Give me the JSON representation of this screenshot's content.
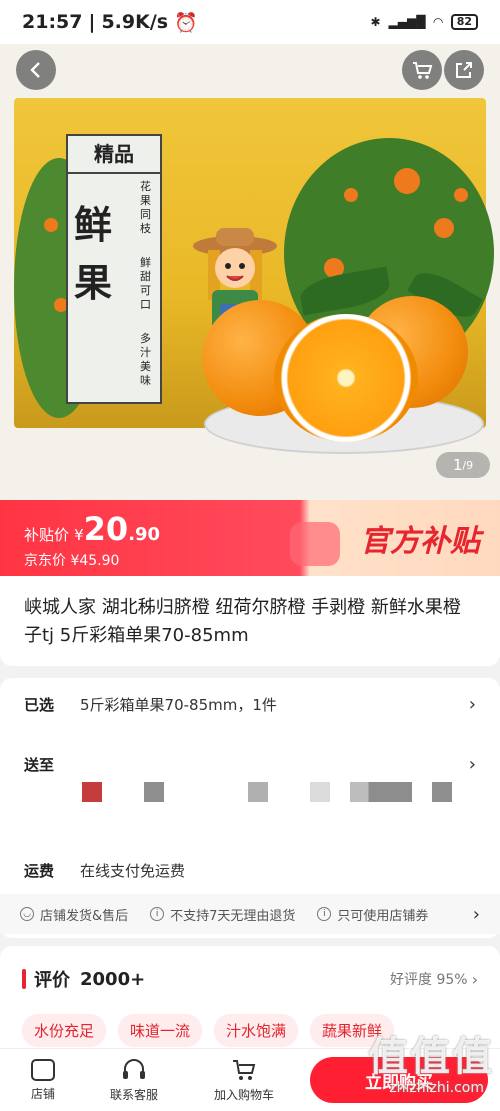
{
  "status_bar": {
    "time": "21:57",
    "speed": "5.9K/s",
    "battery": "82"
  },
  "gallery": {
    "counter_current": "1",
    "counter_total": "/9",
    "label_top": "精品",
    "label_big": "鲜果",
    "label_side_1": "花果同枝",
    "label_side_2": "鲜甜可口",
    "label_side_3": "多汁美味"
  },
  "price": {
    "subsidy_label": "补贴价",
    "currency": "¥",
    "subsidy_int": "20",
    "subsidy_dec": ".90",
    "jd_label": "京东价",
    "jd_price": "¥45.90",
    "official_badge": "官方补贴"
  },
  "product": {
    "title": "峡城人家 湖北秭归脐橙 纽荷尔脐橙 手剥橙 新鲜水果橙子tj 5斤彩箱单果70-85mm"
  },
  "options": {
    "selected_key": "已选",
    "selected_value": "5斤彩箱单果70-85mm，1件",
    "ship_key": "送至",
    "freight_key": "运费",
    "freight_value": "在线支付免运费"
  },
  "guarantees": [
    "店铺发货&售后",
    "不支持7天无理由退货",
    "只可使用店铺券"
  ],
  "reviews": {
    "title": "评价",
    "count": "2000+",
    "rating": "好评度 95%",
    "tags": [
      "水份充足",
      "味道一流",
      "汁水饱满",
      "蔬果新鲜"
    ]
  },
  "bottom_bar": {
    "shop": "店铺",
    "service": "联系客服",
    "cart": "加入购物车",
    "buy": "立即购买"
  },
  "watermark": {
    "brand": "值值值",
    "url": "zhizhizhi.com"
  },
  "colors": {
    "accent": "#ff1f32",
    "tag_bg": "#ffecec"
  }
}
